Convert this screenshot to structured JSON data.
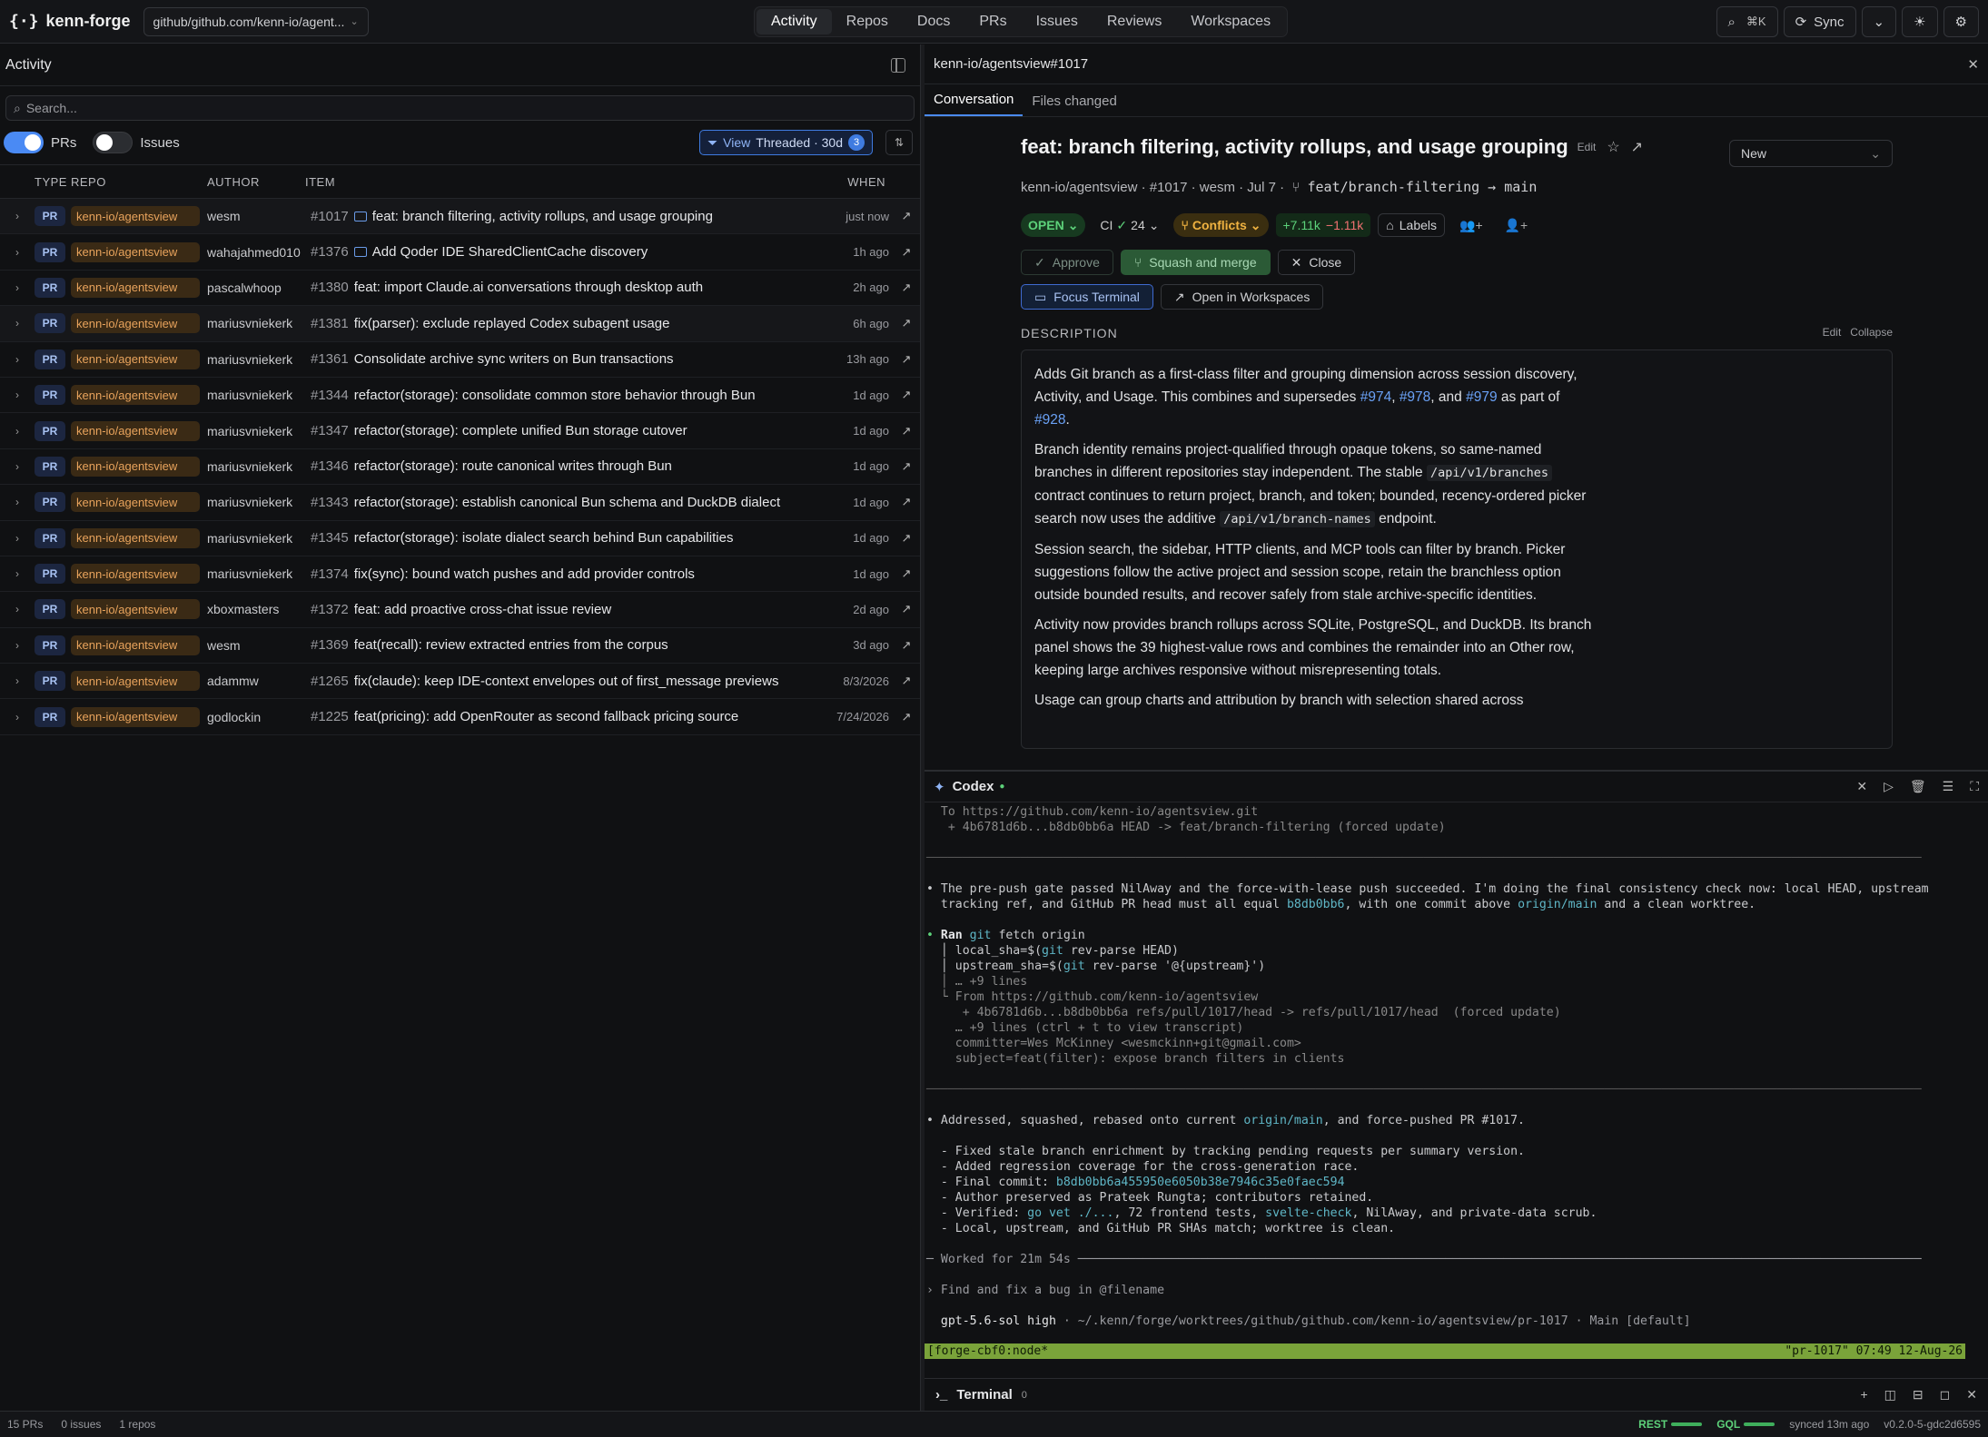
{
  "app": {
    "name": "kenn-forge",
    "repo_selector": "github/github.com/kenn-io/agent..."
  },
  "nav": [
    "Activity",
    "Repos",
    "Docs",
    "PRs",
    "Issues",
    "Reviews",
    "Workspaces"
  ],
  "topright": {
    "search_shortcut": "⌘K",
    "sync_label": "Sync"
  },
  "activity": {
    "title": "Activity",
    "search_placeholder": "Search...",
    "filter_prs": "PRs",
    "filter_issues": "Issues",
    "view_label": "View",
    "view_mode": "Threaded · 30d",
    "view_count": "3",
    "columns": {
      "type": "TYPE",
      "repo": "REPO",
      "author": "AUTHOR",
      "item": "ITEM",
      "when": "WHEN"
    },
    "rows": [
      {
        "type": "PR",
        "repo": "kenn-io/agentsview",
        "author": "wesm",
        "num": "#1017",
        "title": "feat: branch filtering, activity rollups, and usage grouping",
        "when": "just now",
        "msg": true
      },
      {
        "type": "PR",
        "repo": "kenn-io/agentsview",
        "author": "wahajahmed010",
        "num": "#1376",
        "title": "Add Qoder IDE SharedClientCache discovery",
        "when": "1h ago",
        "msg": true
      },
      {
        "type": "PR",
        "repo": "kenn-io/agentsview",
        "author": "pascalwhoop",
        "num": "#1380",
        "title": "feat: import Claude.ai conversations through desktop auth",
        "when": "2h ago"
      },
      {
        "type": "PR",
        "repo": "kenn-io/agentsview",
        "author": "mariusvniekerk",
        "num": "#1381",
        "title": "fix(parser): exclude replayed Codex subagent usage",
        "when": "6h ago"
      },
      {
        "type": "PR",
        "repo": "kenn-io/agentsview",
        "author": "mariusvniekerk",
        "num": "#1361",
        "title": "Consolidate archive sync writers on Bun transactions",
        "when": "13h ago"
      },
      {
        "type": "PR",
        "repo": "kenn-io/agentsview",
        "author": "mariusvniekerk",
        "num": "#1344",
        "title": "refactor(storage): consolidate common store behavior through Bun",
        "when": "1d ago"
      },
      {
        "type": "PR",
        "repo": "kenn-io/agentsview",
        "author": "mariusvniekerk",
        "num": "#1347",
        "title": "refactor(storage): complete unified Bun storage cutover",
        "when": "1d ago"
      },
      {
        "type": "PR",
        "repo": "kenn-io/agentsview",
        "author": "mariusvniekerk",
        "num": "#1346",
        "title": "refactor(storage): route canonical writes through Bun",
        "when": "1d ago"
      },
      {
        "type": "PR",
        "repo": "kenn-io/agentsview",
        "author": "mariusvniekerk",
        "num": "#1343",
        "title": "refactor(storage): establish canonical Bun schema and DuckDB dialect",
        "when": "1d ago"
      },
      {
        "type": "PR",
        "repo": "kenn-io/agentsview",
        "author": "mariusvniekerk",
        "num": "#1345",
        "title": "refactor(storage): isolate dialect search behind Bun capabilities",
        "when": "1d ago"
      },
      {
        "type": "PR",
        "repo": "kenn-io/agentsview",
        "author": "mariusvniekerk",
        "num": "#1374",
        "title": "fix(sync): bound watch pushes and add provider controls",
        "when": "1d ago"
      },
      {
        "type": "PR",
        "repo": "kenn-io/agentsview",
        "author": "xboxmasters",
        "num": "#1372",
        "title": "feat: add proactive cross-chat issue review",
        "when": "2d ago"
      },
      {
        "type": "PR",
        "repo": "kenn-io/agentsview",
        "author": "wesm",
        "num": "#1369",
        "title": "feat(recall): review extracted entries from the corpus",
        "when": "3d ago"
      },
      {
        "type": "PR",
        "repo": "kenn-io/agentsview",
        "author": "adammw",
        "num": "#1265",
        "title": "fix(claude): keep IDE-context envelopes out of first_message previews",
        "when": "8/3/2026"
      },
      {
        "type": "PR",
        "repo": "kenn-io/agentsview",
        "author": "godlockin",
        "num": "#1225",
        "title": "feat(pricing): add OpenRouter as second fallback pricing source",
        "when": "7/24/2026"
      }
    ]
  },
  "pr": {
    "header": "kenn-io/agentsview#1017",
    "tabs": [
      "Conversation",
      "Files changed"
    ],
    "title": "feat: branch filtering, activity rollups, and usage grouping",
    "edit": "Edit",
    "status_select": "New",
    "meta": "kenn-io/agentsview · #1017 · wesm · Jul 7 ·",
    "branch": "feat/branch-filtering → main",
    "state": "OPEN",
    "ci_label": "CI",
    "ci_count": "24",
    "conflicts": "Conflicts",
    "additions": "+7.11k",
    "deletions": "−1.11k",
    "labels": "Labels",
    "approve": "Approve",
    "squash": "Squash and merge",
    "close": "Close",
    "focus_terminal": "Focus Terminal",
    "open_workspaces": "Open in Workspaces",
    "desc_label": "DESCRIPTION",
    "desc_edit": "Edit",
    "desc_collapse": "Collapse",
    "desc": {
      "p1a": "Adds Git branch as a first-class filter and grouping dimension across session discovery, Activity, and Usage. This combines and supersedes ",
      "l974": "#974",
      "l978": "#978",
      "l979": "#979",
      "l928": "#928",
      "p1b": ", ",
      "p1c": ", and ",
      "p1d": " as part of ",
      "p1e": ".",
      "p2a": "Branch identity remains project-qualified through opaque tokens, so same-named branches in different repositories stay independent. The stable ",
      "c1": "/api/v1/branches",
      "p2b": " contract continues to return project, branch, and token; bounded, recency-ordered picker search now uses the additive ",
      "c2": "/api/v1/branch-names",
      "p2c": " endpoint.",
      "p3": "Session search, the sidebar, HTTP clients, and MCP tools can filter by branch. Picker suggestions follow the active project and session scope, retain the branchless option outside bounded results, and recover safely from stale archive-specific identities.",
      "p4": "Activity now provides branch rollups across SQLite, PostgreSQL, and DuckDB. Its branch panel shows the 39 highest-value rows and combines the remainder into an Other row, keeping large archives responsive without misrepresenting totals.",
      "p5": "Usage can group charts and attribution by branch with selection shared across"
    }
  },
  "codex": {
    "title": "Codex",
    "lines": {
      "l1": "  To https://github.com/kenn-io/agentsview.git",
      "l2": "   + 4b6781d6b...b8db0bb6a HEAD -> feat/branch-filtering (forced update)",
      "sep": "──────────────────────────────────────────────────────────────────────────────────────────────────────────────────────────────────────────",
      "m1a": "• The pre-push gate passed NilAway and the force-with-lease push succeeded. I'm doing the final consistency check now: local HEAD, upstream",
      "m1b": "  tracking ref, and GitHub PR head must all equal ",
      "m1sha": "b8db0bb6",
      "m1c": ", with one commit above ",
      "m1ref": "origin/main",
      "m1d": " and a clean worktree.",
      "ran": "Ran",
      "ran_cmd": "git",
      "ran_rest": " fetch origin",
      "r1": "  │ local_sha=$(",
      "r1c": "git",
      "r1d": " rev-parse HEAD)",
      "r2": "  │ upstream_sha=$(",
      "r2c": "git",
      "r2d": " rev-parse '@{upstream}')",
      "r3": "  │ … +9 lines",
      "r4": "  └ From https://github.com/kenn-io/agentsview",
      "r5": "     + 4b6781d6b...b8db0bb6a refs/pull/1017/head -> refs/pull/1017/head  (forced update)",
      "r6": "    … +9 lines (ctrl + t to view transcript)",
      "r7": "    committer=Wes McKinney <wesmckinn+git@gmail.com>",
      "r8": "    subject=feat(filter): expose branch filters in clients",
      "a1a": "• Addressed, squashed, rebased onto current ",
      "a1ref": "origin/main",
      "a1b": ", and force-pushed PR #1017.",
      "b1": "  - Fixed stale branch enrichment by tracking pending requests per summary version.",
      "b2": "  - Added regression coverage for the cross-generation race.",
      "b3a": "  - Final commit: ",
      "b3sha": "b8db0bb6a455950e6050b38e7946c35e0faec594",
      "b4": "  - Author preserved as Prateek Rungta; contributors retained.",
      "b5a": "  - Verified: ",
      "b5c1": "go vet ./...",
      "b5b": ", 72 frontend tests, ",
      "b5c2": "svelte-check",
      "b5c": ", NilAway, and private-data scrub.",
      "b6": "  - Local, upstream, and GitHub PR SHAs match; worktree is clean.",
      "worked": "─ Worked for 21m 54s ─────────────────────────────────────────────────────────────────────────────────────────────────────────────────────",
      "prompt": "› Find and fix a bug in @filename",
      "model": "  gpt-5.6-sol high",
      "path": " · ~/.kenn/forge/worktrees/github/github.com/kenn-io/agentsview/pr-1017 · Main [default]"
    },
    "tmux_left": "[forge-cbf0:node*",
    "tmux_right": "\"pr-1017\" 07:49 12-Aug-26"
  },
  "terminal": {
    "title": "Terminal",
    "count": "0"
  },
  "status": {
    "prs": "15 PRs",
    "issues": "0 issues",
    "repos": "1 repos",
    "rest": "REST",
    "gql": "GQL",
    "synced": "synced 13m ago",
    "version": "v0.2.0-5-gdc2d6595"
  }
}
